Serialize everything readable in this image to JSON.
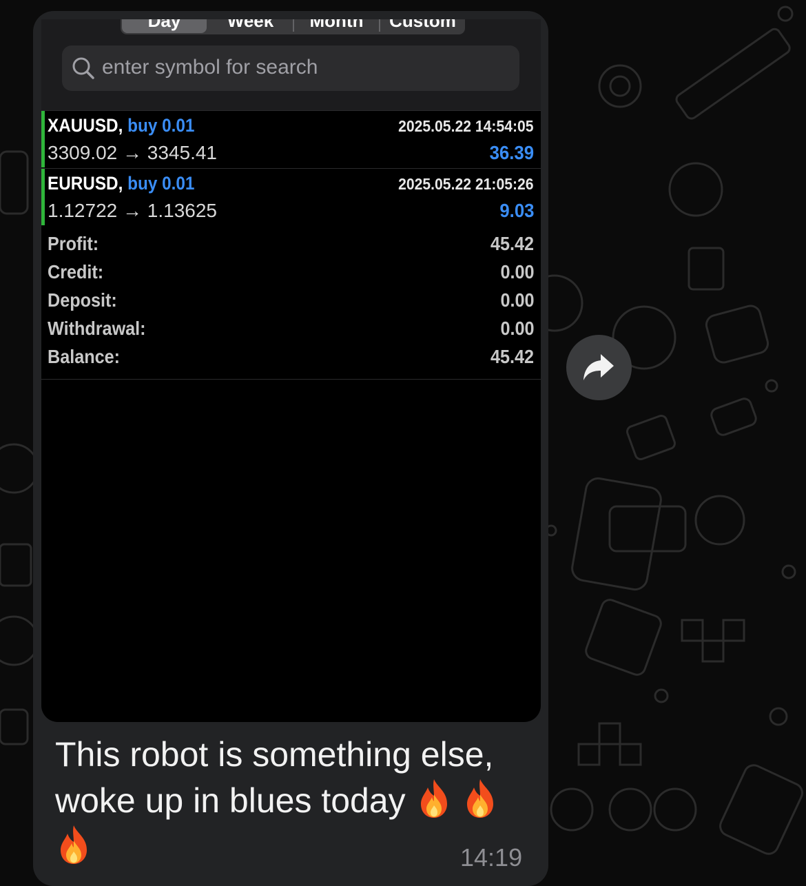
{
  "tabs": [
    "Day",
    "Week",
    "Month",
    "Custom"
  ],
  "search": {
    "placeholder": "enter symbol for search"
  },
  "deals": [
    {
      "symbol": "XAUUSD,",
      "side": "buy 0.01",
      "open": "3309.02",
      "arrow": "→",
      "close": "3345.41",
      "time": "2025.05.22 14:54:05",
      "profit": "36.39"
    },
    {
      "symbol": "EURUSD,",
      "side": "buy 0.01",
      "open": "1.12722",
      "arrow": "→",
      "close": "1.13625",
      "time": "2025.05.22 21:05:26",
      "profit": "9.03"
    }
  ],
  "summary": [
    {
      "label": "Profit:",
      "value": "45.42"
    },
    {
      "label": "Credit:",
      "value": "0.00"
    },
    {
      "label": "Deposit:",
      "value": "0.00"
    },
    {
      "label": "Withdrawal:",
      "value": "0.00"
    },
    {
      "label": "Balance:",
      "value": "45.42"
    }
  ],
  "message": {
    "line1": "This robot is something else,",
    "line2": "woke up in blues today",
    "time": "14:19",
    "emoji": "fire-emoji"
  },
  "colors": {
    "accent": "#3a8df5",
    "buy_bar": "#2fb53a",
    "bubble": "#222325"
  },
  "icons": {
    "search": "search-icon",
    "forward": "forward-icon"
  }
}
